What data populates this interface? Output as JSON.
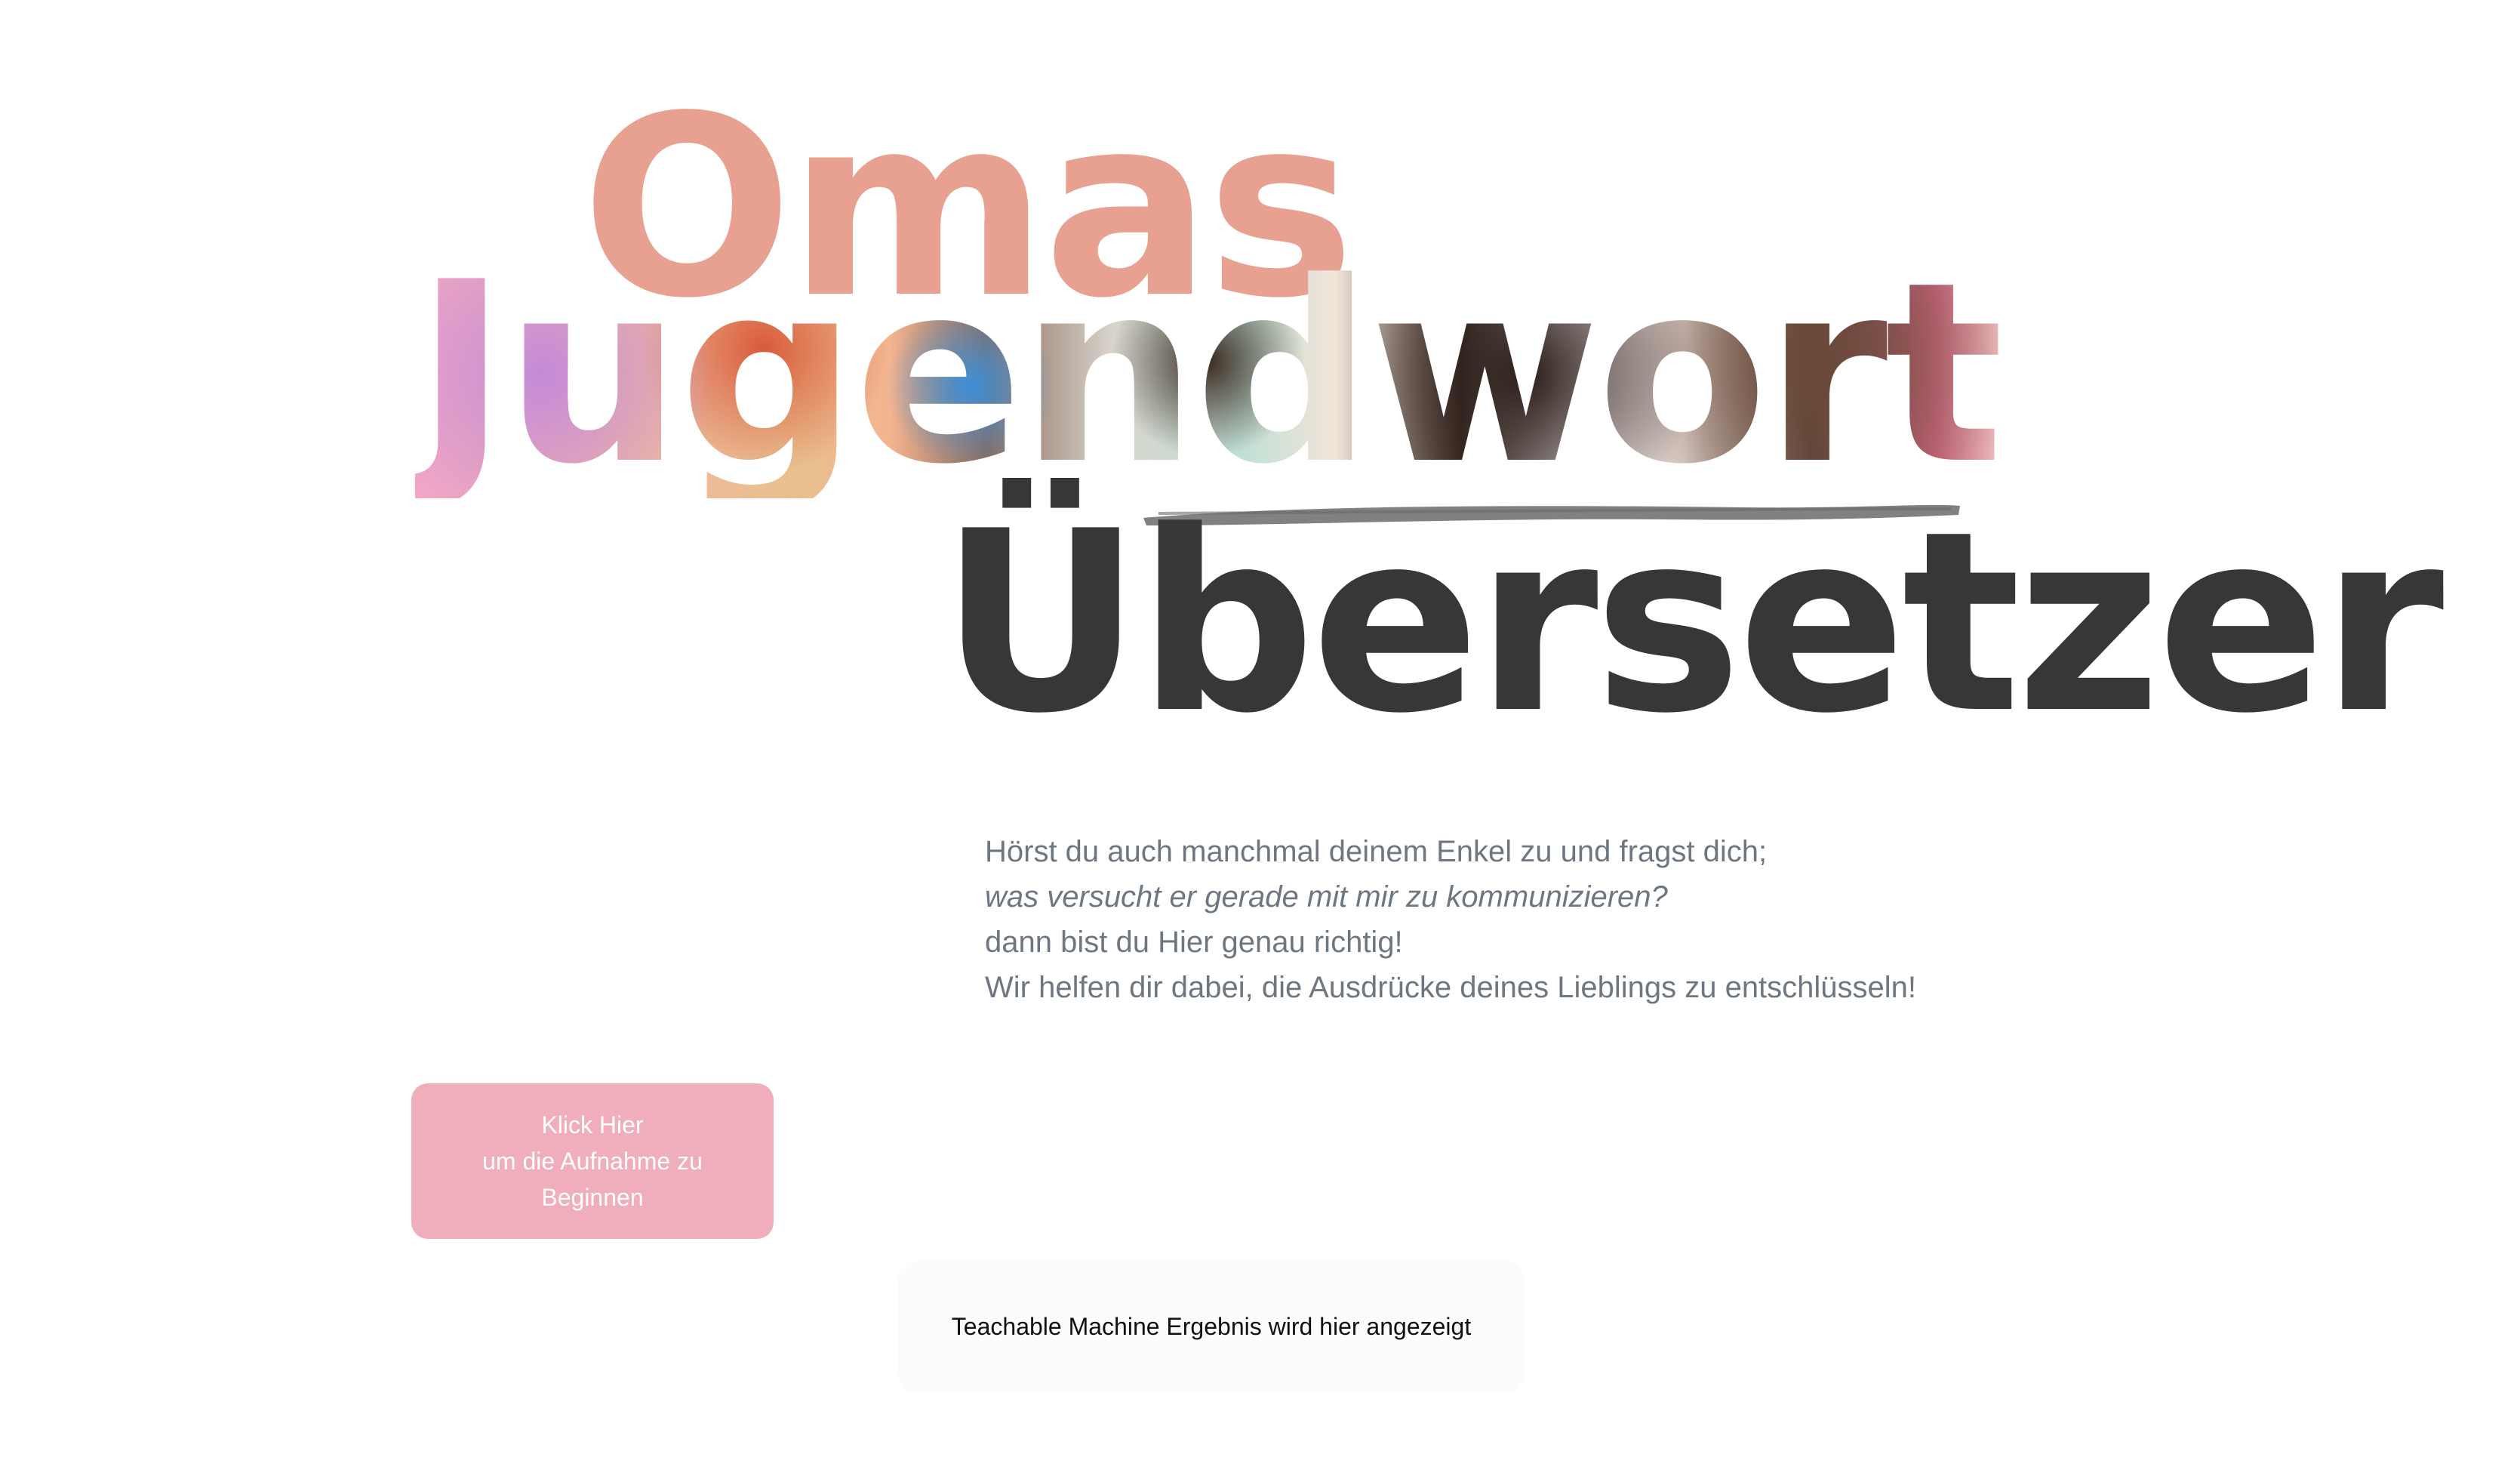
{
  "title": {
    "line1": "Omas",
    "line2": "Jugendwort",
    "line3": "Übersetzer"
  },
  "intro": {
    "line1": "Hörst du auch manchmal deinem Enkel zu und fragst dich;",
    "line2": "was versucht er gerade mit mir zu kommunizieren?",
    "line3": "dann bist du Hier genau richtig!",
    "line4": "Wir helfen dir dabei, die Ausdrücke deines Lieblings zu entschlüsseln!"
  },
  "record_button": {
    "line1": "Klick Hier",
    "line2": "um die Aufnahme zu",
    "line3": "Beginnen"
  },
  "result": {
    "text": "Teachable Machine Ergebnis wird hier angezeigt"
  },
  "colors": {
    "omas": "#e8a090",
    "uebersetzer": "#373737",
    "intro_text": "#6e7780",
    "button_bg": "#f0aeba",
    "underline": "#7a7a7a"
  }
}
